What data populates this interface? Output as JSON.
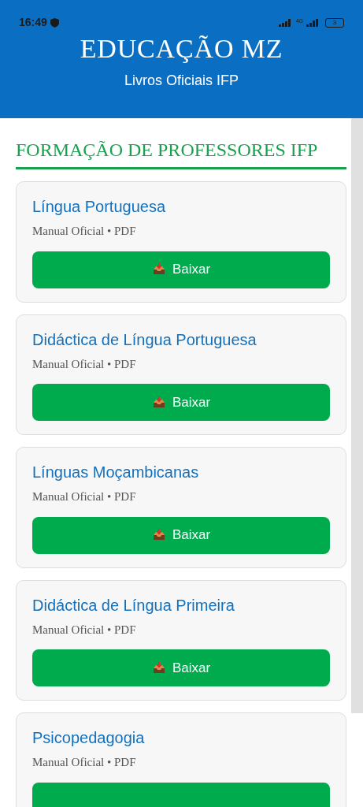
{
  "status_bar": {
    "time": "16:49",
    "network": "4G",
    "battery": "3"
  },
  "header": {
    "title": "EDUCAÇÃO MZ",
    "subtitle": "Livros Oficiais IFP"
  },
  "section": {
    "title": "FORMAÇÃO DE PROFESSORES IFP"
  },
  "books": [
    {
      "title": "Língua Portuguesa",
      "meta": "Manual Oficial • PDF",
      "button": "Baixar"
    },
    {
      "title": "Didáctica de Língua Portuguesa",
      "meta": "Manual Oficial • PDF",
      "button": "Baixar"
    },
    {
      "title": "Línguas Moçambicanas",
      "meta": "Manual Oficial • PDF",
      "button": "Baixar"
    },
    {
      "title": "Didáctica de Língua Primeira",
      "meta": "Manual Oficial • PDF",
      "button": "Baixar"
    },
    {
      "title": "Psicopedagogia",
      "meta": "Manual Oficial • PDF"
    }
  ]
}
